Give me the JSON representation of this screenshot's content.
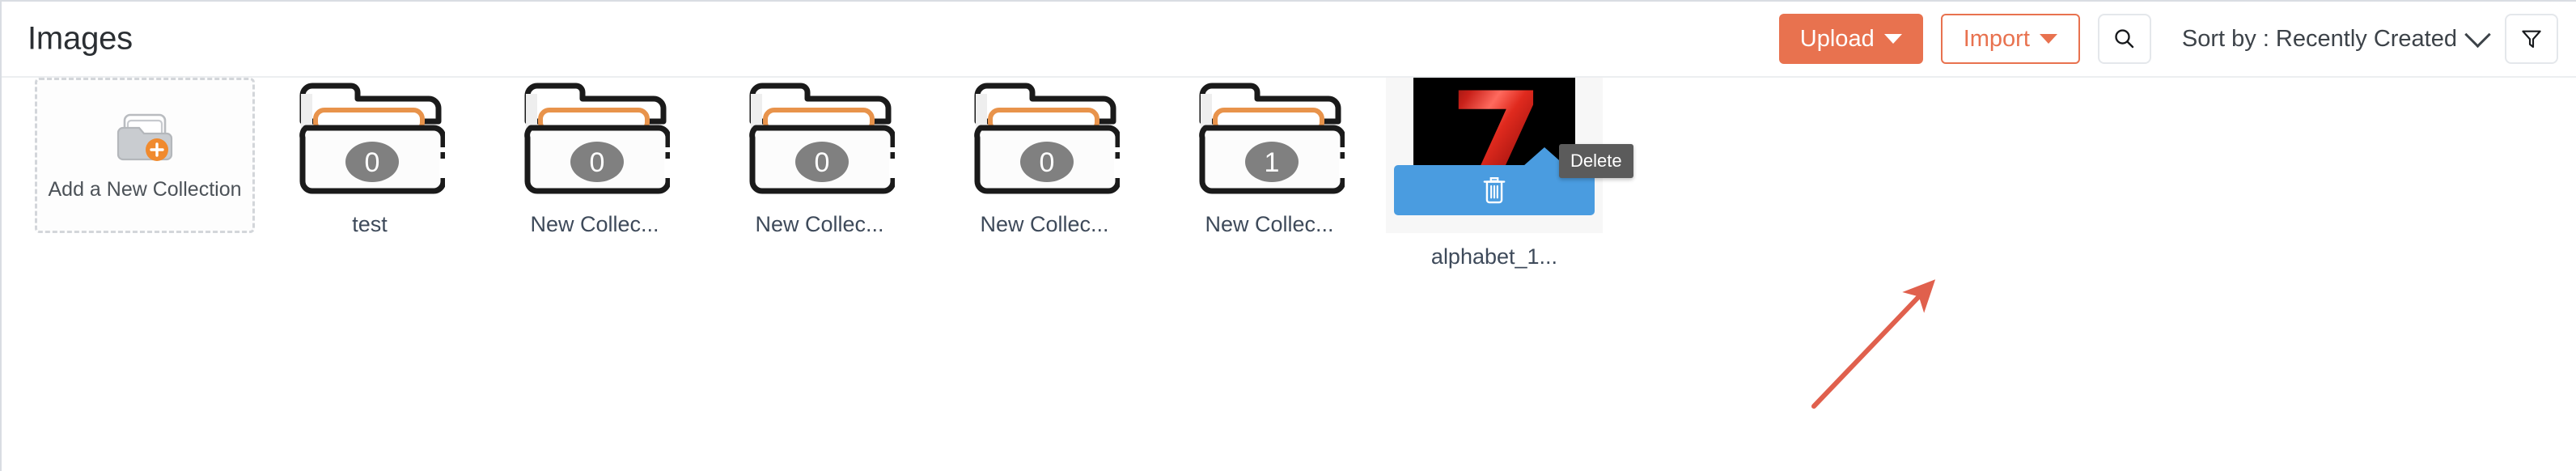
{
  "header": {
    "title": "Images",
    "upload_label": "Upload",
    "import_label": "Import",
    "search_icon": "search-icon",
    "sort_label": "Sort by : Recently Created",
    "filter_icon": "filter-funnel-icon",
    "accent_color": "#e8724f"
  },
  "content": {
    "add_collection": {
      "label": "Add a New Collection",
      "icon": "folder-plus-icon"
    },
    "collections": [
      {
        "name": "test",
        "count": "0"
      },
      {
        "name": "New Collec...",
        "count": "0"
      },
      {
        "name": "New Collec...",
        "count": "0"
      },
      {
        "name": "New Collec...",
        "count": "0"
      },
      {
        "name": "New Collec...",
        "count": "1"
      }
    ],
    "images": [
      {
        "name": "alphabet_1...",
        "thumbnail_text": "7",
        "overlay": {
          "action_icon": "trash-icon",
          "tooltip": "Delete",
          "color": "#4a9ce0"
        }
      }
    ]
  },
  "annotation": {
    "arrow_color": "#e0604d"
  }
}
